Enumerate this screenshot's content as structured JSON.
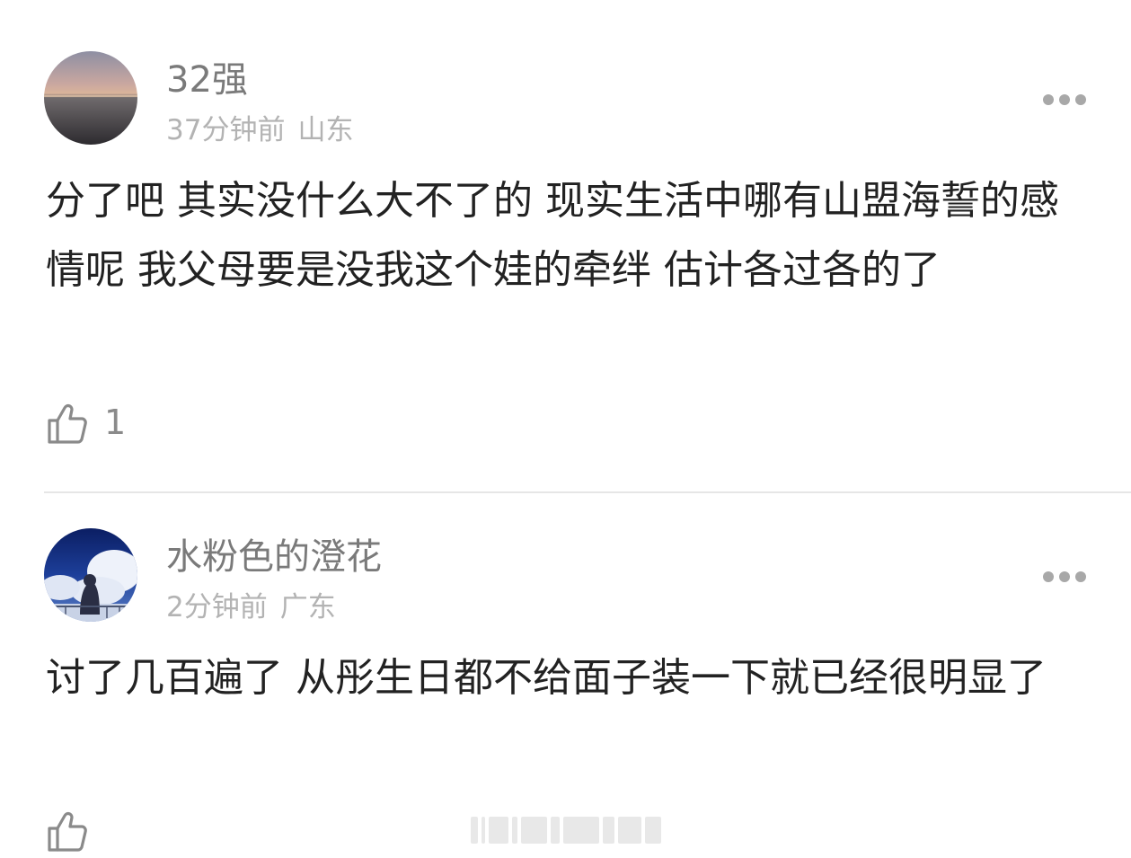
{
  "comments": [
    {
      "username": "32强",
      "time": "37分钟前",
      "location": "山东",
      "text": "分了吧 其实没什么大不了的 现实生活中哪有山盟海誓的感情呢 我父母要是没我这个娃的牵绊 估计各过各的了",
      "likes": "1",
      "avatar": "sunset-sea-avatar"
    },
    {
      "username": "水粉色的澄花",
      "time": "2分钟前",
      "location": "广东",
      "text": "讨了几百遍了 从彤生日都不给面子装一下就已经很明显了",
      "likes": "",
      "avatar": "anime-sky-avatar"
    }
  ],
  "colors": {
    "username": "#7a7a7a",
    "meta": "#b3b3b3",
    "text": "#222222",
    "icon": "#8a8a8a",
    "divider": "#e6e6e6"
  }
}
